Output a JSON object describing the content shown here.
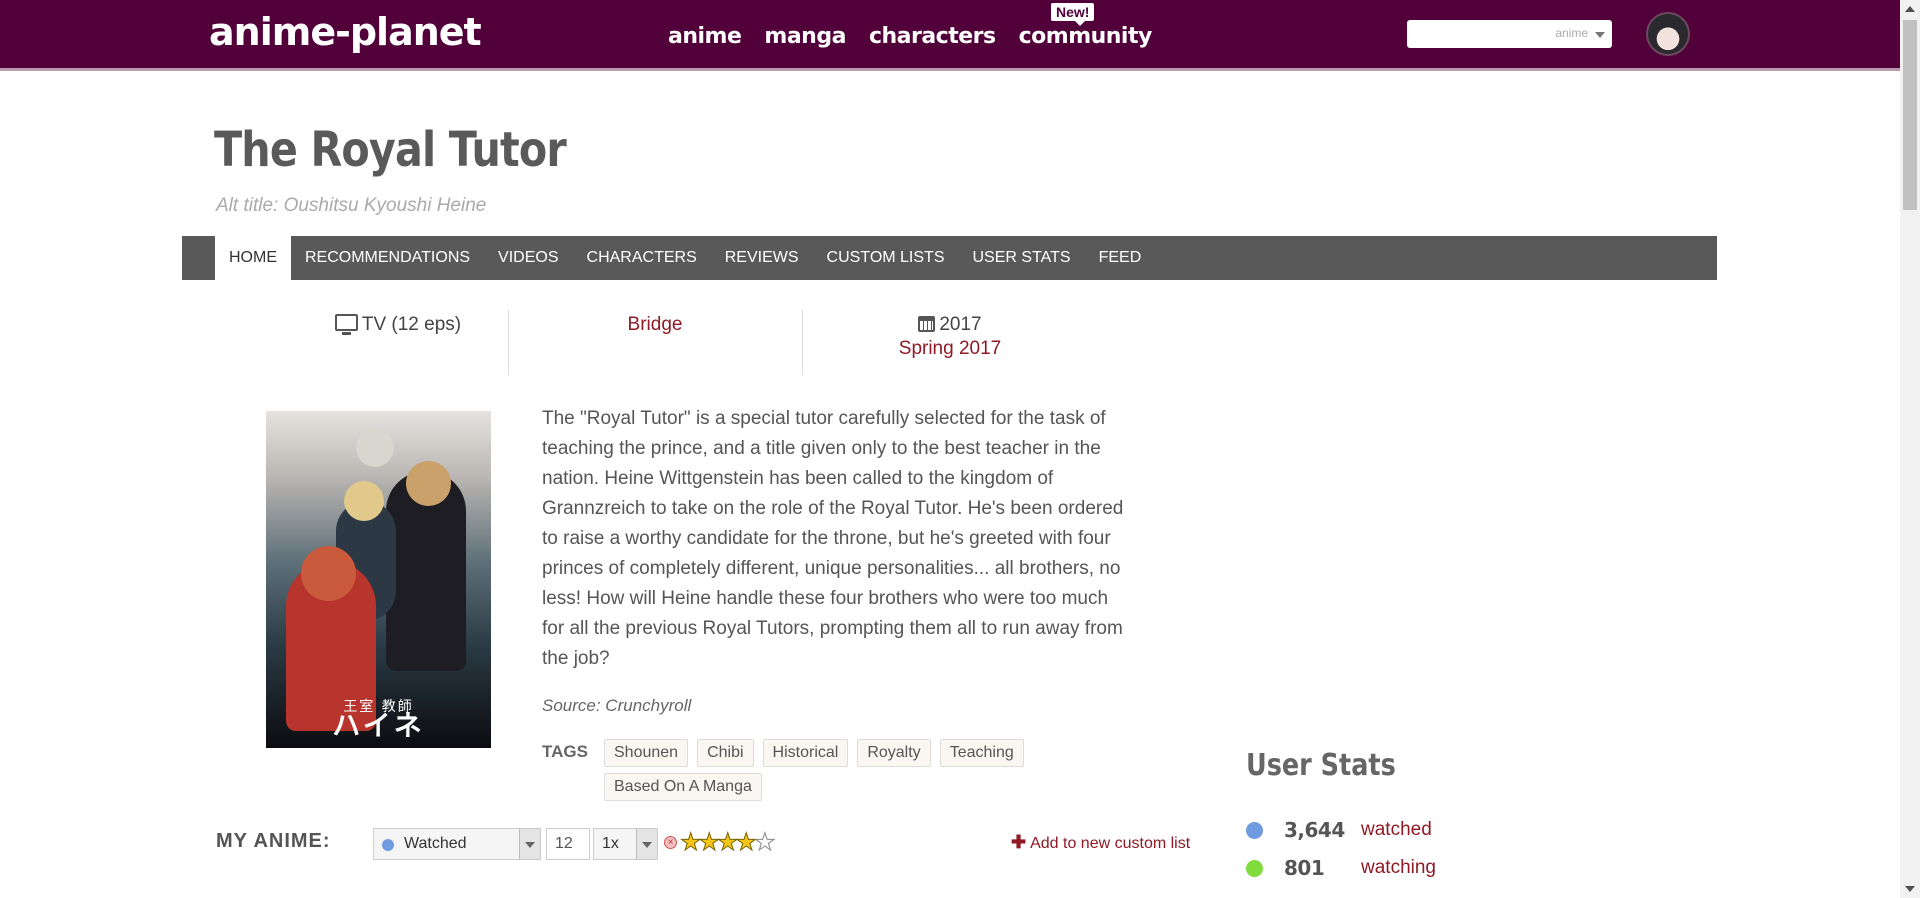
{
  "header": {
    "logo": "anime-planet",
    "nav": [
      "anime",
      "manga",
      "characters",
      "community"
    ],
    "new_badge": "New!",
    "search_placeholder": "",
    "search_scope": "anime"
  },
  "title": "The Royal Tutor",
  "alt_title": "Alt title: Oushitsu Kyoushi Heine",
  "tabs": [
    "HOME",
    "RECOMMENDATIONS",
    "VIDEOS",
    "CHARACTERS",
    "REVIEWS",
    "CUSTOM LISTS",
    "USER STATS",
    "FEED"
  ],
  "info": {
    "type": "TV (12 eps)",
    "studio": "Bridge",
    "year": "2017",
    "season": "Spring 2017"
  },
  "poster": {
    "jp_title_small": "王室 教師",
    "jp_title_large": "ハイネ"
  },
  "synopsis": "The \"Royal Tutor\" is a special tutor carefully selected for the task of teaching the prince, and a title given only to the best teacher in the nation. Heine Wittgenstein has been called to the kingdom of Grannzreich to take on the role of the Royal Tutor. He's been ordered to raise a worthy candidate for the throne, but he's greeted with four princes of completely different, unique personalities... all brothers, no less! How will Heine handle these four brothers who were too much for all the previous Royal Tutors, prompting them all to run away from the job?",
  "source": "Source: Crunchyroll",
  "tags_label": "TAGS",
  "tags": [
    "Shounen",
    "Chibi",
    "Historical",
    "Royalty",
    "Teaching",
    "Based On A Manga"
  ],
  "my_anime": {
    "label": "MY ANIME:",
    "status": "Watched",
    "status_color": "#6f9be0",
    "episodes": "12",
    "times": "1x",
    "rating_stars": 4,
    "rating_max": 5,
    "add_list": "Add to new custom list"
  },
  "user_stats": {
    "heading": "User Stats",
    "rows": [
      {
        "count": "3,644",
        "label": "watched",
        "color": "#6f9be0"
      },
      {
        "count": "801",
        "label": "watching",
        "color": "#7fdc3c"
      }
    ]
  }
}
